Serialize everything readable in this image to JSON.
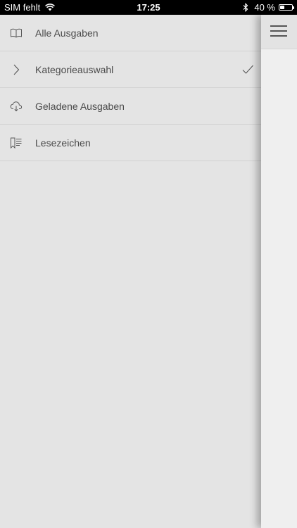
{
  "status_bar": {
    "carrier": "SIM fehlt",
    "time": "17:25",
    "battery_percent": "40 %",
    "battery_level": 0.4
  },
  "menu": {
    "items": [
      {
        "label": "Alle Ausgaben",
        "icon": "book-icon",
        "selected": false
      },
      {
        "label": "Kategorieauswahl",
        "icon": "chevron-right-icon",
        "selected": true
      },
      {
        "label": "Geladene Ausgaben",
        "icon": "cloud-download-icon",
        "selected": false
      },
      {
        "label": "Lesezeichen",
        "icon": "bookmark-list-icon",
        "selected": false
      }
    ]
  },
  "colors": {
    "menu_background": "#e4e4e4",
    "content_background": "#efefef",
    "status_bar": "#000000",
    "text": "#4a4a4a"
  }
}
